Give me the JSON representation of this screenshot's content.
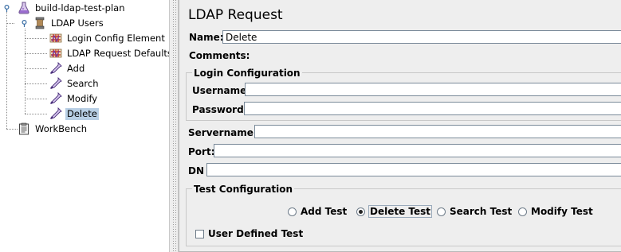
{
  "tree": {
    "root": {
      "label": "build-ldap-test-plan",
      "icon": "test-plan-flask-icon"
    },
    "thread_group": {
      "label": "LDAP Users",
      "icon": "thread-group-spool-icon"
    },
    "items": [
      {
        "label": "Login Config Element",
        "icon": "config-element-icon"
      },
      {
        "label": "LDAP Request Defaults",
        "icon": "config-element-icon"
      },
      {
        "label": "Add",
        "icon": "sampler-pipette-icon"
      },
      {
        "label": "Search",
        "icon": "sampler-pipette-icon"
      },
      {
        "label": "Modify",
        "icon": "sampler-pipette-icon"
      },
      {
        "label": "Delete",
        "icon": "sampler-pipette-icon",
        "selected": true
      }
    ],
    "workbench": {
      "label": "WorkBench",
      "icon": "workbench-clipboard-icon"
    }
  },
  "panel": {
    "title": "LDAP Request",
    "name_label": "Name:",
    "name_value": "Delete",
    "comments_label": "Comments:",
    "login_group_title": "Login Configuration",
    "username_label": "Username",
    "username_value": "",
    "password_label": "Password",
    "password_value": "",
    "servername_label": "Servername :",
    "servername_value": "",
    "port_label": "Port:",
    "port_value": "",
    "dn_label": "DN",
    "dn_value": "",
    "test_group_title": "Test Configuration",
    "test_options": [
      {
        "label": "Add Test",
        "selected": false
      },
      {
        "label": "Delete Test",
        "selected": true
      },
      {
        "label": "Search Test",
        "selected": false
      },
      {
        "label": "Modify Test",
        "selected": false
      }
    ],
    "user_defined_label": "User Defined Test",
    "user_defined_checked": false
  },
  "colors": {
    "selection": "#b8cfe5",
    "panel_bg": "#eeeeee",
    "field_border": "#7a8a99"
  }
}
